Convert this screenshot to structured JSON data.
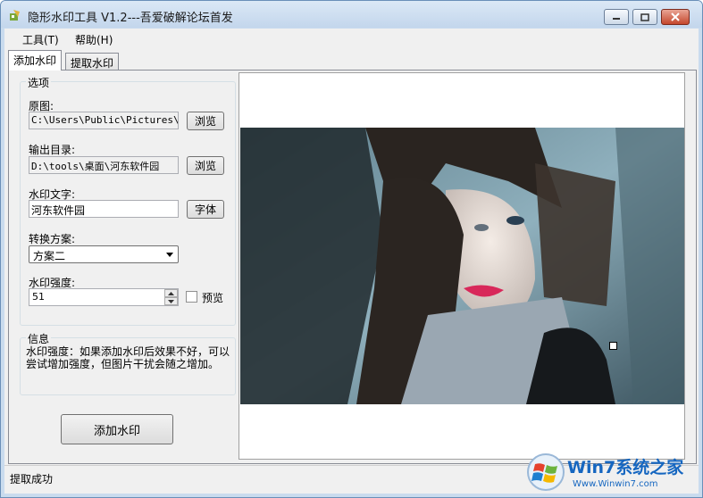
{
  "window": {
    "title": "隐形水印工具 V1.2---吾爱破解论坛首发"
  },
  "menu": {
    "tools": "工具(T)",
    "help": "帮助(H)"
  },
  "tabs": {
    "add": "添加水印",
    "extract": "提取水印"
  },
  "options": {
    "group_title": "选项",
    "source_label": "原图:",
    "source_value": "C:\\Users\\Public\\Pictures\\Sa",
    "output_label": "输出目录:",
    "output_value": "D:\\tools\\桌面\\河东软件园",
    "browse_label": "浏览",
    "text_label": "水印文字:",
    "text_value": "河东软件园",
    "font_label": "字体",
    "scheme_label": "转换方案:",
    "scheme_value": "方案二",
    "strength_label": "水印强度:",
    "strength_value": "51",
    "preview_label": "预览"
  },
  "info": {
    "group_title": "信息",
    "text": "水印强度：如果添加水印后效果不好，可以尝试增加强度，但图片干扰会随之增加。"
  },
  "actions": {
    "add_watermark": "添加水印"
  },
  "status": {
    "text": "提取成功"
  },
  "brand": {
    "main": "Win7系统之家",
    "url": "Www.Winwin7.com"
  }
}
